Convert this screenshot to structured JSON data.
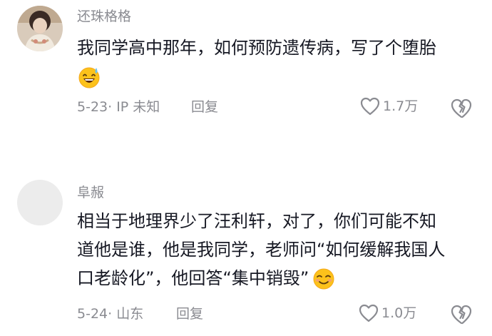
{
  "comments": [
    {
      "username": "还珠格格",
      "text": "我同学高中那年，如何预防遗传病，写了个堕胎",
      "emoji": "grinning-sweat-emoji",
      "date": "5-23",
      "location": "· IP 未知",
      "reply_label": "回复",
      "likes": "1.7万"
    },
    {
      "username": "阜赧",
      "text_lines": [
        "相当于地理界少了汪利轩，对了，你们可能不知",
        "道他是谁，他是我同学，老师问“如何缓解我国人",
        "口老龄化”，他回答“集中销毁”"
      ],
      "emoji": "smiling-blush-emoji",
      "date": "5-24",
      "location": "· 山东",
      "reply_label": "回复",
      "likes": "1.0万"
    }
  ],
  "colors": {
    "secondary_text": "#8a8b91",
    "primary_text": "#161823",
    "emoji_yellow": "#fcc21b"
  }
}
